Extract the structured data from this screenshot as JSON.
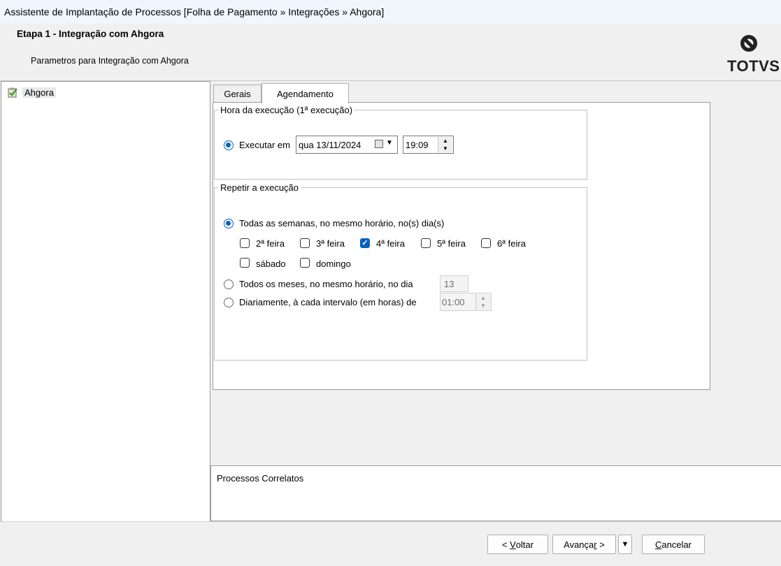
{
  "window": {
    "title": "Assistente de Implantação de Processos [Folha de Pagamento » Integrações » Ahgora]"
  },
  "header": {
    "step_title": "Etapa 1 - Integração com Ahgora",
    "subtitle": "Parametros para Integração com Ahgora",
    "logo_text": "TOTVS"
  },
  "tree": {
    "items": [
      {
        "label": "Ahgora",
        "icon": "checklist-icon"
      }
    ]
  },
  "tabs": [
    {
      "label": "Gerais",
      "active": false
    },
    {
      "label": "Agendamento",
      "active": true
    }
  ],
  "schedule": {
    "group_title": "Hora da execução (1ª execução)",
    "execute_label": "Executar em",
    "execute_checked": true,
    "date_value": "qua 13/11/2024",
    "time_value": "19:09"
  },
  "repeat": {
    "group_title": "Repetir a execução",
    "weekly_label": "Todas as semanas, no mesmo horário, no(s) dia(s)",
    "weekly_checked": true,
    "days": [
      {
        "label": "2ª feira",
        "checked": false
      },
      {
        "label": "3ª feira",
        "checked": false
      },
      {
        "label": "4ª feira",
        "checked": true
      },
      {
        "label": "5ª feira",
        "checked": false
      },
      {
        "label": "6ª feira",
        "checked": false
      },
      {
        "label": "sábado",
        "checked": false
      },
      {
        "label": "domingo",
        "checked": false
      }
    ],
    "monthly_label": "Todos os meses, no mesmo horário, no dia",
    "monthly_checked": false,
    "monthly_day": "13",
    "daily_label": "Diariamente, à cada intervalo (em horas) de",
    "daily_checked": false,
    "daily_interval": "01:00"
  },
  "related": {
    "label": "Processos Correlatos"
  },
  "buttons": {
    "back_prefix": "< ",
    "back_u": "V",
    "back_rest": "oltar",
    "next_pre": "Avança",
    "next_u": "r",
    "next_rest": " >",
    "cancel_u": "C",
    "cancel_rest": "ancelar"
  },
  "colors": {
    "accent": "#0a5fbe",
    "titlebar": "#f0f6fc"
  }
}
